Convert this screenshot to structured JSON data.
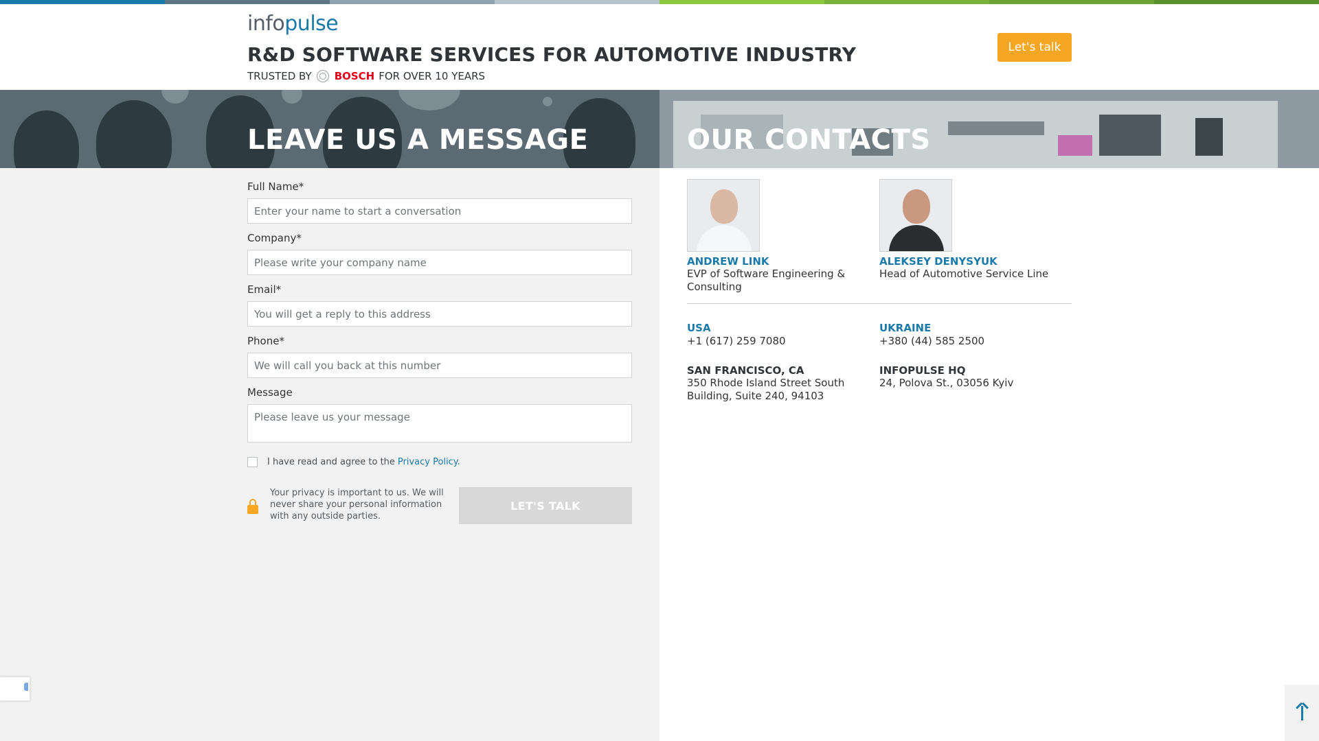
{
  "top_strip": {
    "colors": [
      "#1a7aa8",
      "#5f7785",
      "#8fa3ae",
      "#b5c4cc",
      "#8dc63f",
      "#79b23a",
      "#6aa534",
      "#5a9130"
    ]
  },
  "header": {
    "logo": {
      "part1": "info",
      "part2": "pulse"
    },
    "headline": "R&D SOFTWARE SERVICES FOR AUTOMOTIVE INDUSTRY",
    "trusted_prefix": "TRUSTED BY",
    "trusted_brand": "BOSCH",
    "trusted_suffix": "FOR OVER 10 YEARS",
    "cta_label": "Let's talk"
  },
  "message_section": {
    "title": "LEAVE US A MESSAGE",
    "fields": {
      "full_name": {
        "label": "Full Name*",
        "placeholder": "Enter your name to start a conversation"
      },
      "company": {
        "label": "Company*",
        "placeholder": "Please write your company name"
      },
      "email": {
        "label": "Email*",
        "placeholder": "You will get a reply to this address"
      },
      "phone": {
        "label": "Phone*",
        "placeholder": "We will call you back at this number"
      },
      "message": {
        "label": "Message",
        "placeholder": "Please leave us your message"
      }
    },
    "agree_text": "I have read and agree to the",
    "policy_link": "Privacy Policy.",
    "privacy_note": "Your privacy is important to us. We will never share your personal information with any outside parties.",
    "submit_label": "LET'S TALK"
  },
  "contacts_section": {
    "title": "OUR CONTACTS",
    "people": [
      {
        "name": "ANDREW LINK",
        "role": "EVP of Software Engineering & Consulting"
      },
      {
        "name": "ALEKSEY DENYSYUK",
        "role": "Head of Automotive Service Line"
      }
    ],
    "offices": [
      {
        "country": "USA",
        "phone": "+1 (617) 259 7080",
        "office": "SAN FRANCISCO, CA",
        "address": "350 Rhode Island Street South Building, Suite 240, 94103"
      },
      {
        "country": "UKRAINE",
        "phone": "+380 (44) 585 2500",
        "office": "INFOPULSE HQ",
        "address": "24, Polova St., 03056 Kyiv"
      }
    ]
  },
  "colors": {
    "accent_orange": "#f5a623",
    "link_blue": "#1a7aa8",
    "bosch_red": "#e2001a"
  },
  "icons": [
    "bosch-logo-icon",
    "lock-icon",
    "arrow-up-icon",
    "recaptcha-icon"
  ]
}
